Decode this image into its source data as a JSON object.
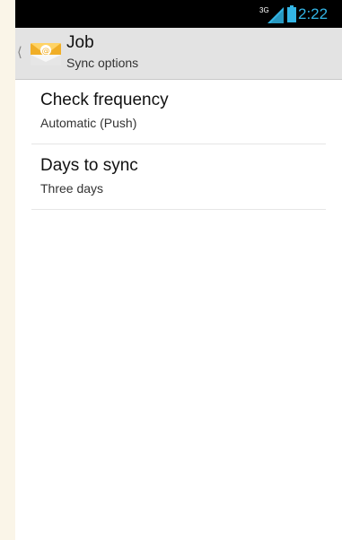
{
  "status_bar": {
    "network_label": "3G",
    "time": "2:22",
    "accent_color": "#33b5e5",
    "network_icon": "signal-icon",
    "battery_icon": "battery-icon"
  },
  "action_bar": {
    "up_icon": "chevron-left-icon",
    "app_icon": "email-app-icon",
    "title": "Job",
    "subtitle": "Sync options"
  },
  "preferences": [
    {
      "title": "Check frequency",
      "summary": "Automatic (Push)"
    },
    {
      "title": "Days to sync",
      "summary": "Three days"
    }
  ]
}
